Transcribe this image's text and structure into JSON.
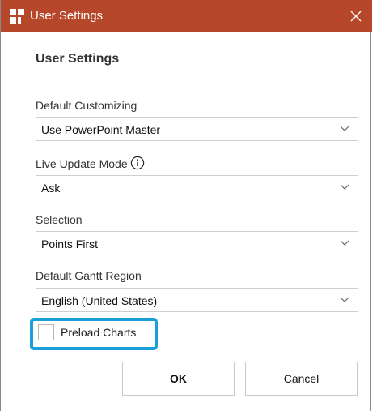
{
  "window": {
    "title": "User Settings",
    "accent_color": "#b7472a",
    "close_label": "close"
  },
  "content": {
    "heading": "User Settings",
    "fields": [
      {
        "label": "Default Customizing",
        "value": "Use PowerPoint Master"
      },
      {
        "label": "Live Update Mode",
        "value": "Ask",
        "has_info_icon": true
      },
      {
        "label": "Selection",
        "value": "Points First"
      },
      {
        "label": "Default Gantt Region",
        "value": "English (United States)"
      }
    ],
    "preload_charts": {
      "label": "Preload Charts",
      "checked": false,
      "highlight_color": "#1aa0d8"
    }
  },
  "buttons": {
    "ok": "OK",
    "cancel": "Cancel"
  }
}
